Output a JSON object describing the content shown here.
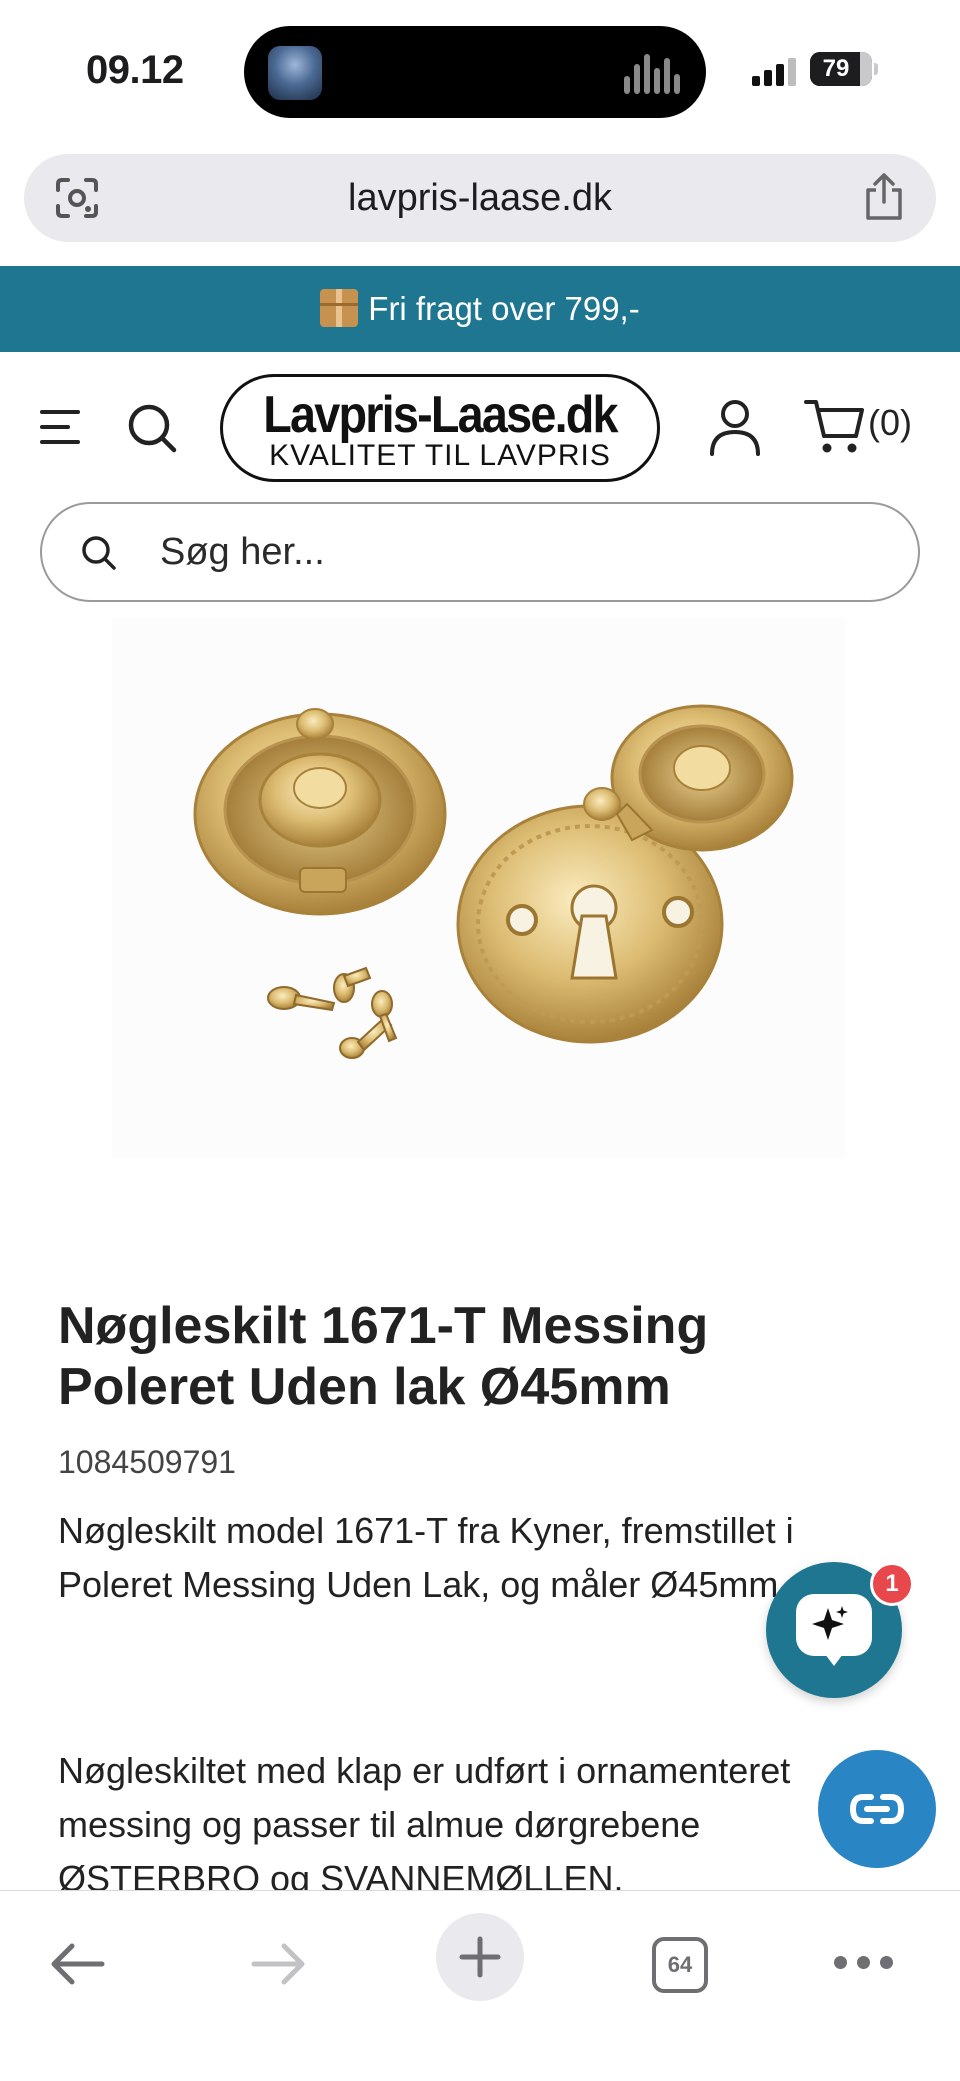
{
  "status_bar": {
    "time": "09.12",
    "battery": "79",
    "battery_level_percent": 79,
    "icons": [
      "now-playing-artwork-icon",
      "audio-waveform-icon",
      "cellular-signal-icon",
      "battery-icon"
    ]
  },
  "browser": {
    "url": "lavpris-laase.dk",
    "icons": [
      "visual-search-icon",
      "share-icon"
    ]
  },
  "banner": {
    "text": "Fri fragt over 799,-",
    "icon": "package-icon"
  },
  "header": {
    "logo_main": "Lavpris-Laase.dk",
    "logo_sub": "KVALITET TIL LAVPRIS",
    "cart_count": "(0)",
    "icons": [
      "menu-icon",
      "search-icon",
      "account-icon",
      "cart-icon"
    ]
  },
  "search": {
    "placeholder": "Søg her..."
  },
  "product": {
    "title": "Nøgleskilt 1671-T Messing Poleret Uden lak Ø45mm",
    "sku": "1084509791",
    "description_1": "Nøgleskilt model 1671-T fra Kyner, fremstillet i Poleret Messing Uden Lak, og måler Ø45mm.",
    "description_2": "Nøgleskiltet med klap er udført i ornamenteret messing og passer til almue dørgrebene ØSTERBRO og SVANNEMØLLEN."
  },
  "chat": {
    "badge": "1",
    "icon": "chat-sparkle-icon"
  },
  "link_button": {
    "icon": "link-icon"
  },
  "toolbar": {
    "tab_count": "64",
    "icons": [
      "back-arrow-icon",
      "forward-arrow-icon",
      "plus-icon",
      "tabs-icon",
      "more-icon"
    ]
  },
  "colors": {
    "brand_teal": "#1e7690",
    "link_blue": "#2a85c4",
    "badge_red": "#e8474c",
    "brass": "#d9b86a"
  }
}
